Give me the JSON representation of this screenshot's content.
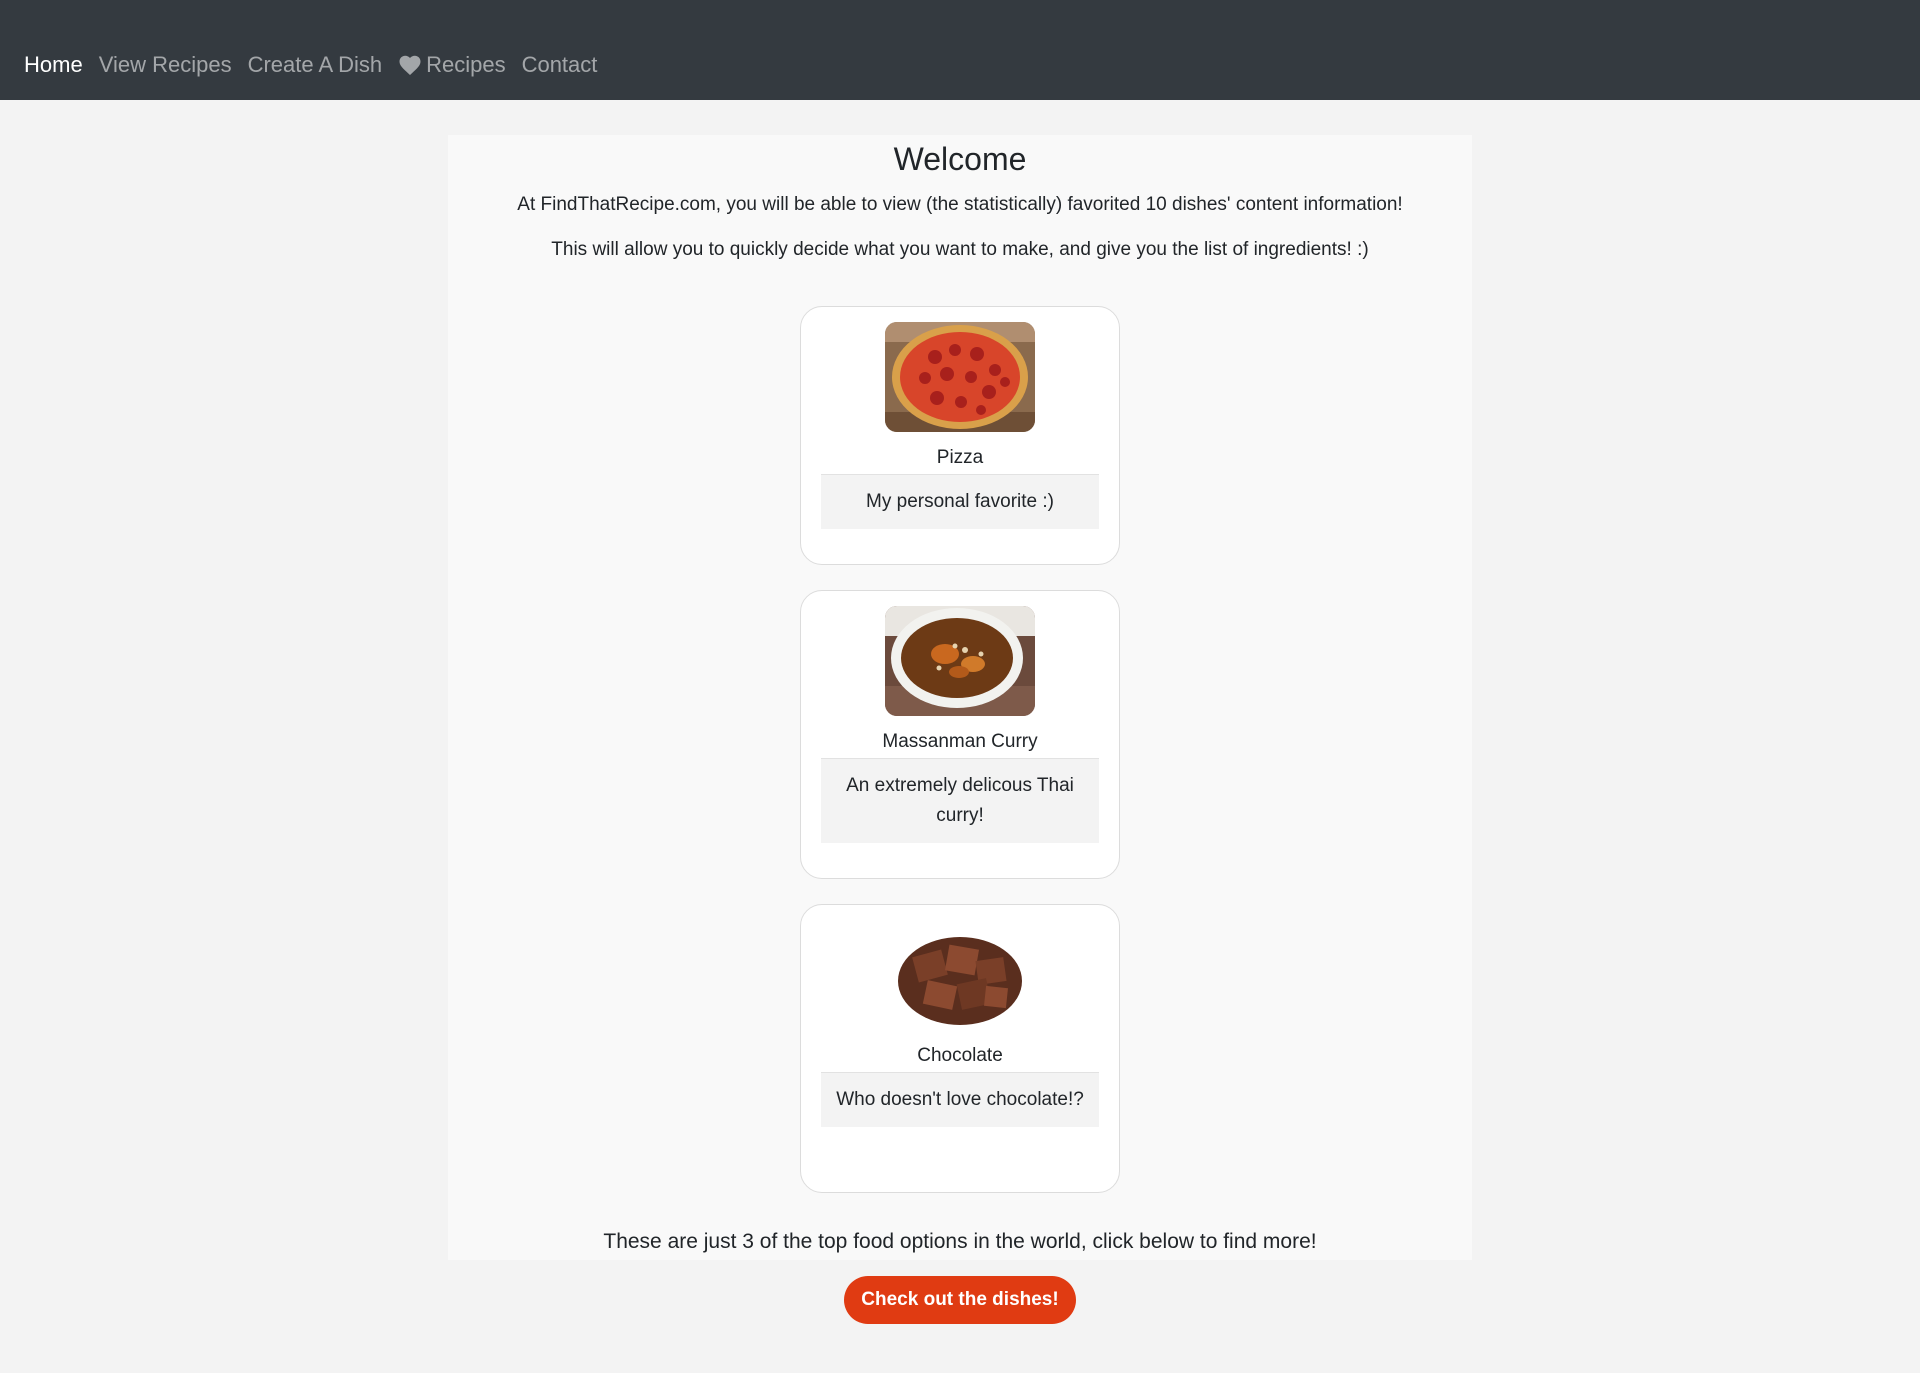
{
  "nav": {
    "items": [
      {
        "label": "Home",
        "active": true
      },
      {
        "label": "View Recipes",
        "active": false
      },
      {
        "label": "Create A Dish",
        "active": false
      },
      {
        "label": "Recipes",
        "active": false,
        "icon": "heart-icon"
      },
      {
        "label": "Contact",
        "active": false
      }
    ]
  },
  "main": {
    "title": "Welcome",
    "intro": [
      "At FindThatRecipe.com, you will be able to view (the statistically) favorited 10 dishes' content information!",
      "This will allow you to quickly decide what you want to make, and give you the list of ingredients! :)"
    ],
    "cards": [
      {
        "title": "Pizza",
        "description": "My personal favorite :)",
        "image": "pizza-image"
      },
      {
        "title": "Massanman Curry",
        "description": "An extremely delicous Thai curry!",
        "image": "curry-image"
      },
      {
        "title": "Chocolate",
        "description": "Who doesn't love chocolate!?",
        "image": "chocolate-image"
      }
    ],
    "footer_text": "These are just 3 of the top food options in the world, click below to find more!",
    "cta_label": "Check out the dishes!"
  },
  "colors": {
    "navbar": "#343a40",
    "cta": "#e03b12",
    "page_bg": "#f3f3f3",
    "content_bg": "#f9f9f9"
  }
}
